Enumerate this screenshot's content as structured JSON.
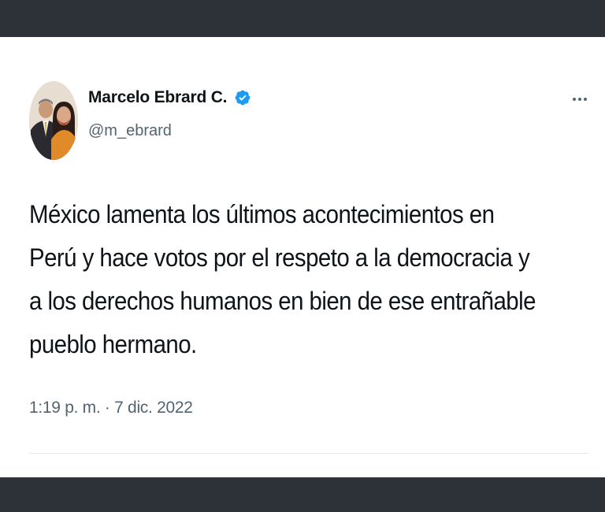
{
  "tweet": {
    "author": {
      "display_name": "Marcelo Ebrard C.",
      "handle": "@m_ebrard",
      "verified": true,
      "avatar_icon": "profile-photo"
    },
    "text": "México lamenta los últimos acontecimientos en Perú y hace votos por el respeto a la democracia y a los derechos humanos en bien de ese entrañable pueblo hermano.",
    "timestamp": "1:19 p. m. · 7 dic. 2022",
    "more_icon": "more-horizontal-icon"
  },
  "colors": {
    "frame": "#2d3238",
    "text_primary": "#0f1419",
    "text_secondary": "#536471",
    "verified_blue": "#1d9bf0",
    "divider": "#e6e9eb"
  }
}
